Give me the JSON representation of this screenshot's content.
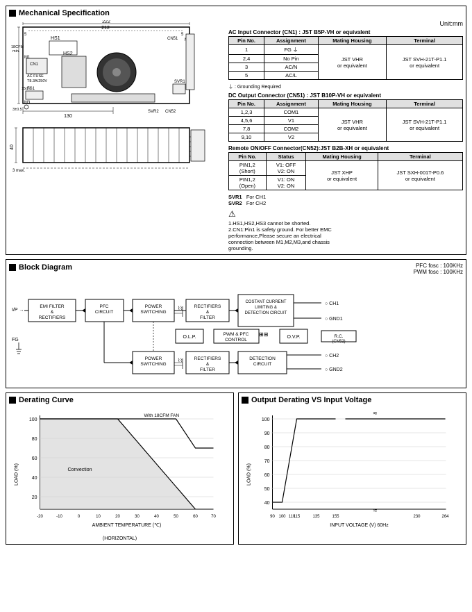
{
  "title": "Mechanical Specification",
  "unit": "Unit:mm",
  "ac_connector": {
    "title": "AC Input Connector (CN1) : JST B5P-VH or equivalent",
    "headers": [
      "Pin No.",
      "Assignment",
      "Mating Housing",
      "Terminal"
    ],
    "rows": [
      [
        "1",
        "FG ⏚",
        "",
        ""
      ],
      [
        "2,4",
        "No Pin",
        "JST VHR or equivalent",
        "JST SVH-21T-P1.1 or equivalent"
      ],
      [
        "3",
        "AC/N",
        "",
        ""
      ],
      [
        "5",
        "AC/L",
        "",
        ""
      ]
    ],
    "note": "⏚ : Grounding Required"
  },
  "dc_connector": {
    "title": "DC Output Connector (CN51) : JST B10P-VH or equivalent",
    "headers": [
      "Pin No.",
      "Assignment",
      "Mating Housing",
      "Terminal"
    ],
    "rows": [
      [
        "1,2,3",
        "COM1",
        "",
        ""
      ],
      [
        "4,5,6",
        "V1",
        "JST VHR or equivalent",
        "JST SVH-21T-P1.1 or equivalent"
      ],
      [
        "7,8",
        "COM2",
        "",
        ""
      ],
      [
        "9,10",
        "V2",
        "",
        ""
      ]
    ]
  },
  "remote_connector": {
    "title": "Remote ON/OFF Connector(CN52):JST B2B-XH or equivalent",
    "headers": [
      "Pin No.",
      "Status",
      "Mating Housing",
      "Terminal"
    ],
    "rows": [
      [
        "PIN1,2 (Short)",
        "V1: OFF V2: ON",
        "JST XHP or equivalent",
        "JST SXH-001T-P0.6 or equivalent"
      ],
      [
        "PIN1,2 (Open)",
        "V1: ON V2: ON",
        "",
        ""
      ]
    ]
  },
  "svr_labels": [
    {
      "label": "SVR1",
      "value": "For CH1"
    },
    {
      "label": "SVR2",
      "value": "For CH2"
    }
  ],
  "warning_notes": [
    "1.HS1,HS2,HS3 cannot be shorted.",
    "2.CN1:Pin1 is safety ground. For better EMC performance,Please secure an electrical connection between M1,M2,M3,and chassis grounding."
  ],
  "block_diagram": {
    "title": "Block Diagram",
    "pfc_fosc": "PFC fosc : 100KHz",
    "pwm_fosc": "PWM fosc : 100KHz",
    "blocks": [
      "EMI FILTER & RECTIFIERS",
      "PFC CIRCUIT",
      "POWER SWITCHING",
      "RECTIFIERS & FILTER",
      "COSTANT CURRENT LIMITING & DETECTION CIRCUIT",
      "O.L.P.",
      "PWM & PFC CONTROL",
      "O.V.P.",
      "POWER SWITCHING",
      "RECTIFIERS & FILTER",
      "DETECTION CIRCUIT"
    ],
    "labels": [
      "I/P →",
      "FG",
      "CH1",
      "GND1",
      "R.C. (CN52)",
      "CH2",
      "GND2"
    ]
  },
  "derating_curve": {
    "title": "Derating Curve",
    "x_label": "AMBIENT TEMPERATURE (℃)",
    "y_label": "LOAD (%)",
    "x_axis": [
      "-20",
      "-10",
      "0",
      "10",
      "20",
      "30",
      "40",
      "50",
      "60",
      "70"
    ],
    "x_suffix": "(HORIZONTAL)",
    "fan_label": "With 18CFM FAN",
    "convection_label": "Convection",
    "y_values": [
      "100",
      "80",
      "60",
      "40",
      "20"
    ]
  },
  "output_derating": {
    "title": "Output Derating VS Input Voltage",
    "x_label": "INPUT VOLTAGE (V) 60Hz",
    "y_label": "LOAD (%)",
    "x_axis": [
      "90",
      "100",
      "110",
      "115",
      "135",
      "155",
      "230",
      "264"
    ],
    "y_values": [
      "100",
      "90",
      "80",
      "70",
      "60",
      "50",
      "40"
    ]
  }
}
